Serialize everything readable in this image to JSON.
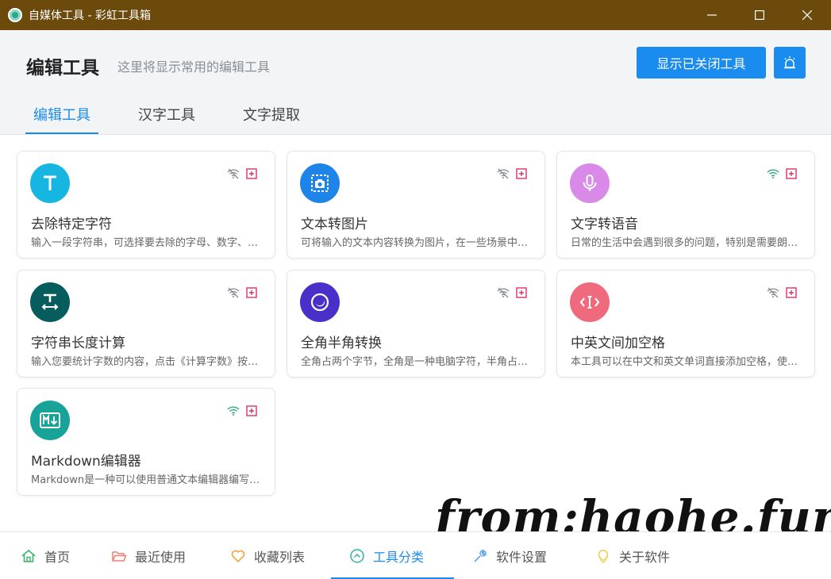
{
  "window": {
    "title": "自媒体工具 - 彩虹工具箱"
  },
  "header": {
    "title": "编辑工具",
    "subtitle": "这里将显示常用的编辑工具",
    "show_closed_label": "显示已关闭工具"
  },
  "tabs": [
    {
      "label": "编辑工具",
      "active": true
    },
    {
      "label": "汉字工具",
      "active": false
    },
    {
      "label": "文字提取",
      "active": false
    }
  ],
  "cards": [
    {
      "title": "去除特定字符",
      "desc": "输入一段字符串，可选择要去除的字母、数字、汉字等字符",
      "icon": "letter-t-icon",
      "color": "#17b6e0",
      "online": false
    },
    {
      "title": "文本转图片",
      "desc": "可将输入的文本内容转换为图片，在一些场景中非常实用",
      "icon": "image-capture-icon",
      "color": "#1e84e8",
      "online": false
    },
    {
      "title": "文字转语音",
      "desc": "日常的生活中会遇到很多的问题，特别是需要朗读的时候",
      "icon": "microphone-icon",
      "color": "#d98ae8",
      "online": true
    },
    {
      "title": "字符串长度计算",
      "desc": "输入您要统计字数的内容，点击《计算字数》按钮即可",
      "icon": "text-width-icon",
      "color": "#075c5e",
      "online": false
    },
    {
      "title": "全角半角转换",
      "desc": "全角占两个字节，全角是一种电脑字符，半角占一个字节",
      "icon": "moon-icon",
      "color": "#4a2fc8",
      "online": false
    },
    {
      "title": "中英文间加空格",
      "desc": "本工具可以在中文和英文单词直接添加空格，使排版更美观",
      "icon": "code-cursor-icon",
      "color": "#f06a7e",
      "online": false
    },
    {
      "title": "Markdown编辑器",
      "desc": "Markdown是一种可以使用普通文本编辑器编写的标记语言",
      "icon": "markdown-icon",
      "color": "#17a39a",
      "online": true
    }
  ],
  "footer": {
    "items": [
      {
        "label": "首页",
        "icon": "home-icon",
        "color": "#3bb56a"
      },
      {
        "label": "最近使用",
        "icon": "folder-open-icon",
        "color": "#f07f74"
      },
      {
        "label": "收藏列表",
        "icon": "heart-icon",
        "color": "#f5a23a"
      },
      {
        "label": "工具分类",
        "icon": "chevron-up-circle-icon",
        "color": "#2bb3a3",
        "active": true
      },
      {
        "label": "软件设置",
        "icon": "wrench-icon",
        "color": "#6aa8e6"
      },
      {
        "label": "关于软件",
        "icon": "lightbulb-icon",
        "color": "#e8d040"
      }
    ]
  },
  "watermark": "from:haohe.fun",
  "colors": {
    "accent": "#1a8cf0",
    "titlebar": "#6b4a0c",
    "offline_badge": "#8a8f96",
    "online_badge": "#2aa88a",
    "add_badge": "#d6336c"
  }
}
